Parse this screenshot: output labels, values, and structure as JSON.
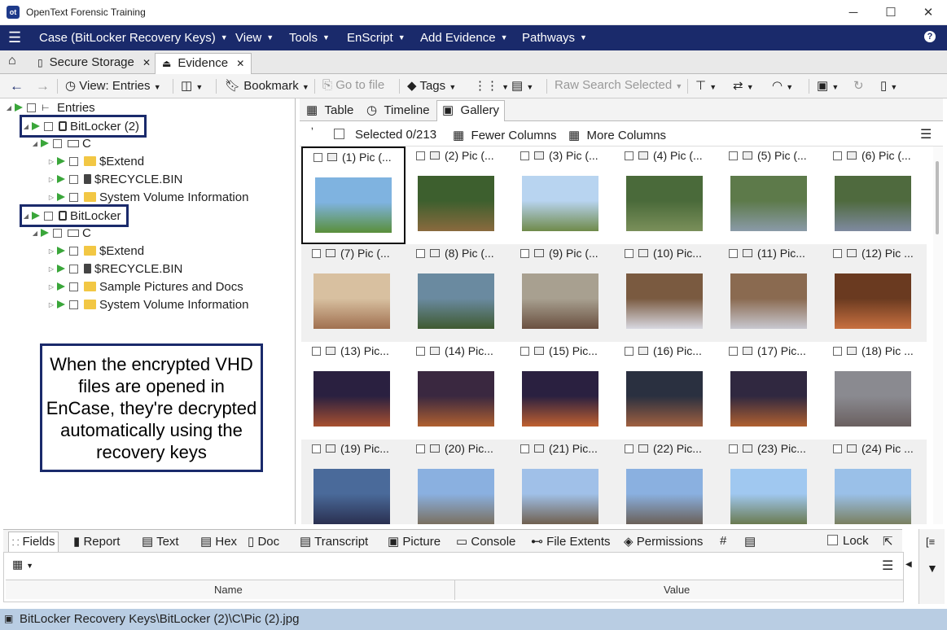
{
  "window": {
    "title": "OpenText Forensic Training",
    "app_badge": "ot",
    "minimize": "─",
    "maximize": "☐",
    "close": "✕"
  },
  "menu": {
    "items": [
      "Case (BitLocker Recovery Keys)",
      "View",
      "Tools",
      "EnScript",
      "Add Evidence",
      "Pathways"
    ],
    "help": "?"
  },
  "doc_tabs": [
    {
      "label": "Secure Storage",
      "close": "✕"
    },
    {
      "label": "Evidence",
      "close": "✕"
    }
  ],
  "toolbar": {
    "view": "View: Entries",
    "bookmark": "Bookmark",
    "go_to_file": "Go to file",
    "tags": "Tags",
    "raw_search": "Raw Search Selected"
  },
  "tree": {
    "root": "Entries",
    "items": [
      {
        "label": "BitLocker (2)"
      },
      {
        "label": "C"
      },
      {
        "label": "$Extend"
      },
      {
        "label": "$RECYCLE.BIN"
      },
      {
        "label": "System Volume Information"
      },
      {
        "label": "BitLocker"
      },
      {
        "label": "C"
      },
      {
        "label": "$Extend"
      },
      {
        "label": "$RECYCLE.BIN"
      },
      {
        "label": "Sample Pictures and Docs"
      },
      {
        "label": "System Volume Information"
      }
    ]
  },
  "callout": "When the encrypted VHD files are opened in EnCase, they're decrypted automatically using the recovery keys",
  "view_tabs": [
    "Table",
    "Timeline",
    "Gallery"
  ],
  "gallery": {
    "selected": "Selected 0/213",
    "fewer": "Fewer Columns",
    "more": "More Columns",
    "items": [
      "(1) Pic (...",
      "(2) Pic (...",
      "(3) Pic (...",
      "(4) Pic (...",
      "(5) Pic (...",
      "(6) Pic (...",
      "(7) Pic (...",
      "(8) Pic (...",
      "(9) Pic (...",
      "(10) Pic...",
      "(11) Pic...",
      "(12) Pic ...",
      "(13) Pic...",
      "(14) Pic...",
      "(15) Pic...",
      "(16) Pic...",
      "(17) Pic...",
      "(18) Pic ...",
      "(19) Pic...",
      "(20) Pic...",
      "(21) Pic...",
      "(22) Pic...",
      "(23) Pic...",
      "(24) Pic ..."
    ]
  },
  "bottom_tabs": [
    "Fields",
    "Report",
    "Text",
    "Hex",
    "Doc",
    "Transcript",
    "Picture",
    "Console",
    "File Extents",
    "Permissions"
  ],
  "lock_label": "Lock",
  "fields_columns": {
    "name": "Name",
    "value": "Value"
  },
  "status": "BitLocker Recovery Keys\\BitLocker (2)\\C\\Pic (2).jpg"
}
